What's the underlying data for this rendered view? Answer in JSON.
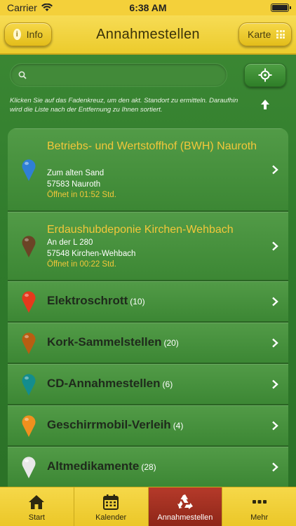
{
  "status": {
    "carrier": "Carrier",
    "time": "6:38 AM"
  },
  "header": {
    "title": "Annahmestellen",
    "info_label": "Info",
    "map_label": "Karte"
  },
  "search": {
    "placeholder": "",
    "value": ""
  },
  "hint": "Klicken Sie auf das Fadenkreuz, um den akt. Standort zu ermitteln. Daraufhin wird die Liste nach der Entfernung zu Ihnen sortiert.",
  "sites": [
    {
      "name": "Betriebs- und Wertstoffhof (BWH) Nauroth",
      "street": "Zum alten Sand",
      "city": "57583 Nauroth",
      "opens": "Öffnet in 01:52 Std.",
      "pin_color": "#2f7fd6"
    },
    {
      "name": "Erdaushubdeponie Kirchen-Wehbach",
      "street": "An der L 280",
      "city": "57548 Kirchen-Wehbach",
      "opens": "Öffnet in 00:22 Std.",
      "pin_color": "#6b4426"
    }
  ],
  "categories": [
    {
      "label": "Elektroschrott",
      "count": "(10)",
      "pin_color": "#e5391c"
    },
    {
      "label": "Kork-Sammelstellen",
      "count": "(20)",
      "pin_color": "#b85e12"
    },
    {
      "label": "CD-Annahmestellen",
      "count": "(6)",
      "pin_color": "#138d8d"
    },
    {
      "label": "Geschirrmobil-Verleih",
      "count": "(4)",
      "pin_color": "#f0901e"
    },
    {
      "label": "Altmedikamente",
      "count": "(28)",
      "pin_color": "#e8e8e8"
    }
  ],
  "tabs": [
    {
      "label": "Start",
      "icon": "home-icon"
    },
    {
      "label": "Kalender",
      "icon": "calendar-icon"
    },
    {
      "label": "Annahmestellen",
      "icon": "recycle-icon",
      "active": true
    },
    {
      "label": "Mehr",
      "icon": "more-icon"
    }
  ],
  "colors": {
    "accent_yellow": "#f4d03a",
    "bg_green": "#3d8a35",
    "active_tab": "#a13022",
    "title_gold": "#f3c73a"
  }
}
